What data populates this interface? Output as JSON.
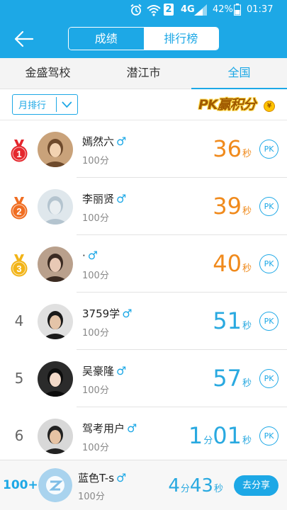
{
  "status_bar": {
    "sim_slot": "2",
    "network": "4G",
    "battery": "42%",
    "time": "01:37"
  },
  "header": {
    "segments": [
      "成绩",
      "排行榜"
    ],
    "active_segment": "排行榜"
  },
  "tabs": [
    {
      "label": "金盛驾校",
      "active": false
    },
    {
      "label": "潜江市",
      "active": false
    },
    {
      "label": "全国",
      "active": true
    }
  ],
  "filter": {
    "dropdown_label": "月排行",
    "banner_text": "PK赢积分",
    "coin_symbol": "¥"
  },
  "leaderboard": [
    {
      "rank": "1",
      "medal": "red",
      "name": "嫣然六",
      "gender": "♂",
      "score": "100分",
      "time": [
        {
          "v": "36",
          "u": "秒"
        }
      ],
      "color": "#f08a1c",
      "pk": "PK"
    },
    {
      "rank": "2",
      "medal": "orange",
      "name": "李丽贤",
      "gender": "♂",
      "score": "100分",
      "time": [
        {
          "v": "39",
          "u": "秒"
        }
      ],
      "color": "#f08a1c",
      "pk": "PK"
    },
    {
      "rank": "3",
      "medal": "gold",
      "name": "·",
      "gender": "♂",
      "score": "100分",
      "time": [
        {
          "v": "40",
          "u": "秒"
        }
      ],
      "color": "#f08a1c",
      "pk": "PK"
    },
    {
      "rank": "4",
      "medal": "",
      "name": "3759学",
      "gender": "♂",
      "score": "100分",
      "time": [
        {
          "v": "51",
          "u": "秒"
        }
      ],
      "color": "#29a9e0",
      "pk": "PK"
    },
    {
      "rank": "5",
      "medal": "",
      "name": "吴豪隆",
      "gender": "♂",
      "score": "100分",
      "time": [
        {
          "v": "57",
          "u": "秒"
        }
      ],
      "color": "#29a9e0",
      "pk": "PK"
    },
    {
      "rank": "6",
      "medal": "",
      "name": "驾考用户",
      "gender": "♂",
      "score": "100分",
      "time": [
        {
          "v": "1",
          "u": "分"
        },
        {
          "v": "01",
          "u": "秒"
        }
      ],
      "color": "#29a9e0",
      "pk": "PK"
    }
  ],
  "my_entry": {
    "rank": "100+",
    "name": "蓝色T-s",
    "gender": "♂",
    "score": "100分",
    "time": [
      {
        "v": "4",
        "u": "分"
      },
      {
        "v": "43",
        "u": "秒"
      }
    ],
    "share_label": "去分享"
  },
  "colors": {
    "primary": "#1da8e6",
    "top_time": "#f08a1c",
    "other_time": "#29a9e0",
    "medal_red": "#e5272d",
    "medal_orange": "#f06d21",
    "medal_gold": "#f2b418"
  }
}
